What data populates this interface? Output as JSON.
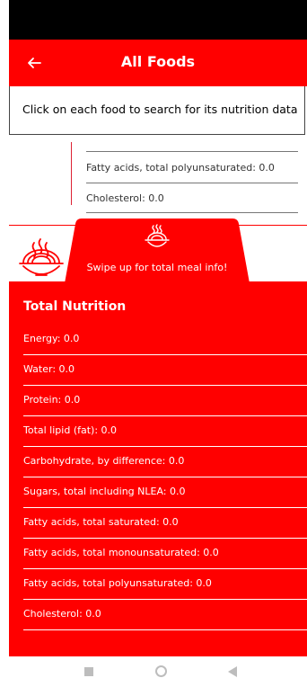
{
  "app_bar": {
    "title": "All Foods",
    "back_icon": "arrow-left-icon"
  },
  "instruction": "Click on each food to search for its nutrition data",
  "food_detail": {
    "rows": [
      "Fatty acids, total polyunsaturated: 0.0",
      "Cholesterol: 0.0"
    ]
  },
  "swipe_tab": {
    "label": "Swipe up for total meal info!",
    "icon": "noodle-bowl-icon"
  },
  "decor_icon": "noodle-bowl-icon",
  "total_nutrition": {
    "title": "Total Nutrition",
    "rows": [
      "Energy: 0.0",
      "Water: 0.0",
      "Protein: 0.0",
      "Total lipid (fat): 0.0",
      "Carbohydrate, by difference: 0.0",
      "Sugars, total including NLEA: 0.0",
      "Fatty acids, total saturated: 0.0",
      "Fatty acids, total monounsaturated: 0.0",
      "Fatty acids, total polyunsaturated: 0.0",
      "Cholesterol: 0.0"
    ]
  },
  "nav_bar": {
    "icons": [
      "recents-square-icon",
      "home-circle-icon",
      "back-triangle-icon"
    ]
  },
  "colors": {
    "accent": "#ff0000",
    "status_bar": "#000000",
    "text_on_accent": "#ffffff"
  }
}
